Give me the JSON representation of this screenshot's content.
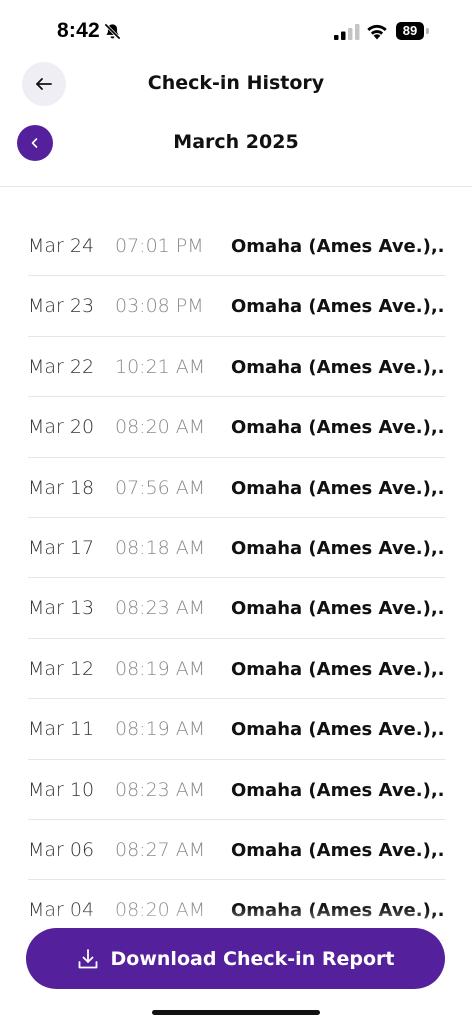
{
  "status_bar": {
    "time": "8:42",
    "battery_level": "89",
    "signal_bars": 2,
    "silent_icon": "bell-slash-icon",
    "wifi_icon": "wifi-icon"
  },
  "header": {
    "title": "Check-in History",
    "back_icon": "arrow-left-icon"
  },
  "month_nav": {
    "label": "March 2025",
    "prev_icon": "chevron-left-icon"
  },
  "history": [
    {
      "date": "Mar 24",
      "time": "07:01 PM",
      "location": "Omaha (Ames Ave.),..."
    },
    {
      "date": "Mar 23",
      "time": "03:08 PM",
      "location": "Omaha (Ames Ave.),..."
    },
    {
      "date": "Mar 22",
      "time": "10:21 AM",
      "location": "Omaha (Ames Ave.),..."
    },
    {
      "date": "Mar 20",
      "time": "08:20 AM",
      "location": "Omaha (Ames Ave.),..."
    },
    {
      "date": "Mar 18",
      "time": "07:56 AM",
      "location": "Omaha (Ames Ave.),..."
    },
    {
      "date": "Mar 17",
      "time": "08:18 AM",
      "location": "Omaha (Ames Ave.),..."
    },
    {
      "date": "Mar 13",
      "time": "08:23 AM",
      "location": "Omaha (Ames Ave.),..."
    },
    {
      "date": "Mar 12",
      "time": "08:19 AM",
      "location": "Omaha (Ames Ave.),..."
    },
    {
      "date": "Mar 11",
      "time": "08:19 AM",
      "location": "Omaha (Ames Ave.),..."
    },
    {
      "date": "Mar 10",
      "time": "08:23 AM",
      "location": "Omaha (Ames Ave.),..."
    },
    {
      "date": "Mar 06",
      "time": "08:27 AM",
      "location": "Omaha (Ames Ave.),..."
    },
    {
      "date": "Mar 04",
      "time": "08:20 AM",
      "location": "Omaha (Ames Ave.),..."
    }
  ],
  "footer": {
    "download_label": "Download Check-in Report",
    "download_icon": "download-icon"
  },
  "colors": {
    "accent": "#55209c",
    "back_button_bg": "#efeef5",
    "divider": "#e6e6e6",
    "time_text": "#8a8a8a"
  }
}
